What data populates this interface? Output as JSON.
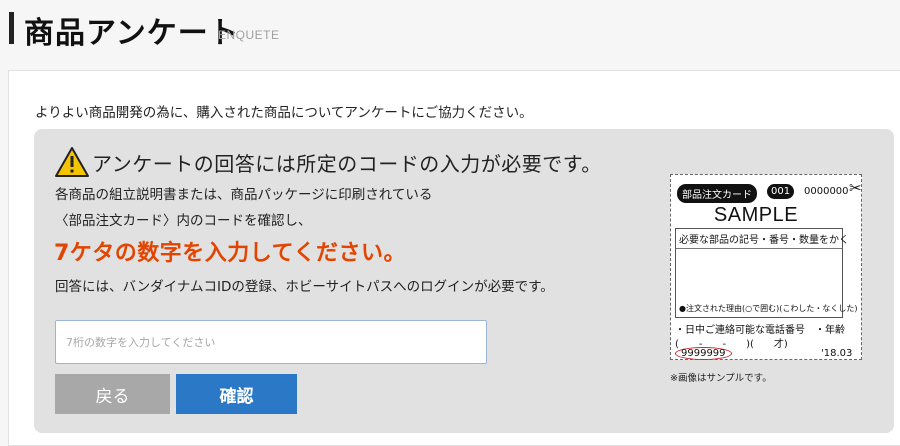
{
  "header": {
    "title": "商品アンケート",
    "subtitle": "ENQUETE"
  },
  "main": {
    "intro": "よりよい商品開発の為に、購入された商品についてアンケートにご協力ください。",
    "notice": {
      "heading": "アンケートの回答には所定のコードの入力が必要です。",
      "line1": "各商品の組立説明書または、商品パッケージに印刷されている",
      "line2": "〈部品注文カード〉内のコードを確認し、",
      "emphasis": "7ケタの数字を入力してください。",
      "line3": "回答には、バンダイナムコIDの登録、ホビーサイトパスへのログインが必要です。"
    },
    "code_input": {
      "placeholder": "7桁の数字を入力してください",
      "value": ""
    },
    "buttons": {
      "back": "戻る",
      "confirm": "確認"
    },
    "sample_card": {
      "label": "部品注文カード",
      "number": "001",
      "serial": "0000000",
      "sample": "SAMPLE",
      "box_heading": "必要な部品の記号・番号・数量をかく",
      "reason": "●注文された理由(○で囲む)(こわした・なくした)",
      "phone_line": "・日中ご連絡可能な電話番号　・年齢",
      "paren_line": "(　　-　　-　　)(　　才)",
      "code": "9999999",
      "date": "'18.03",
      "note": "※画像はサンプルです。"
    }
  },
  "colors": {
    "accent_orange": "#e34400",
    "confirm_blue": "#2a78c6",
    "back_gray": "#a8a8a8",
    "panel_gray": "#e1e1e1",
    "warning_yellow": "#f5c400"
  },
  "icons": {
    "warning": "warning-icon",
    "scissors": "scissors-icon"
  }
}
